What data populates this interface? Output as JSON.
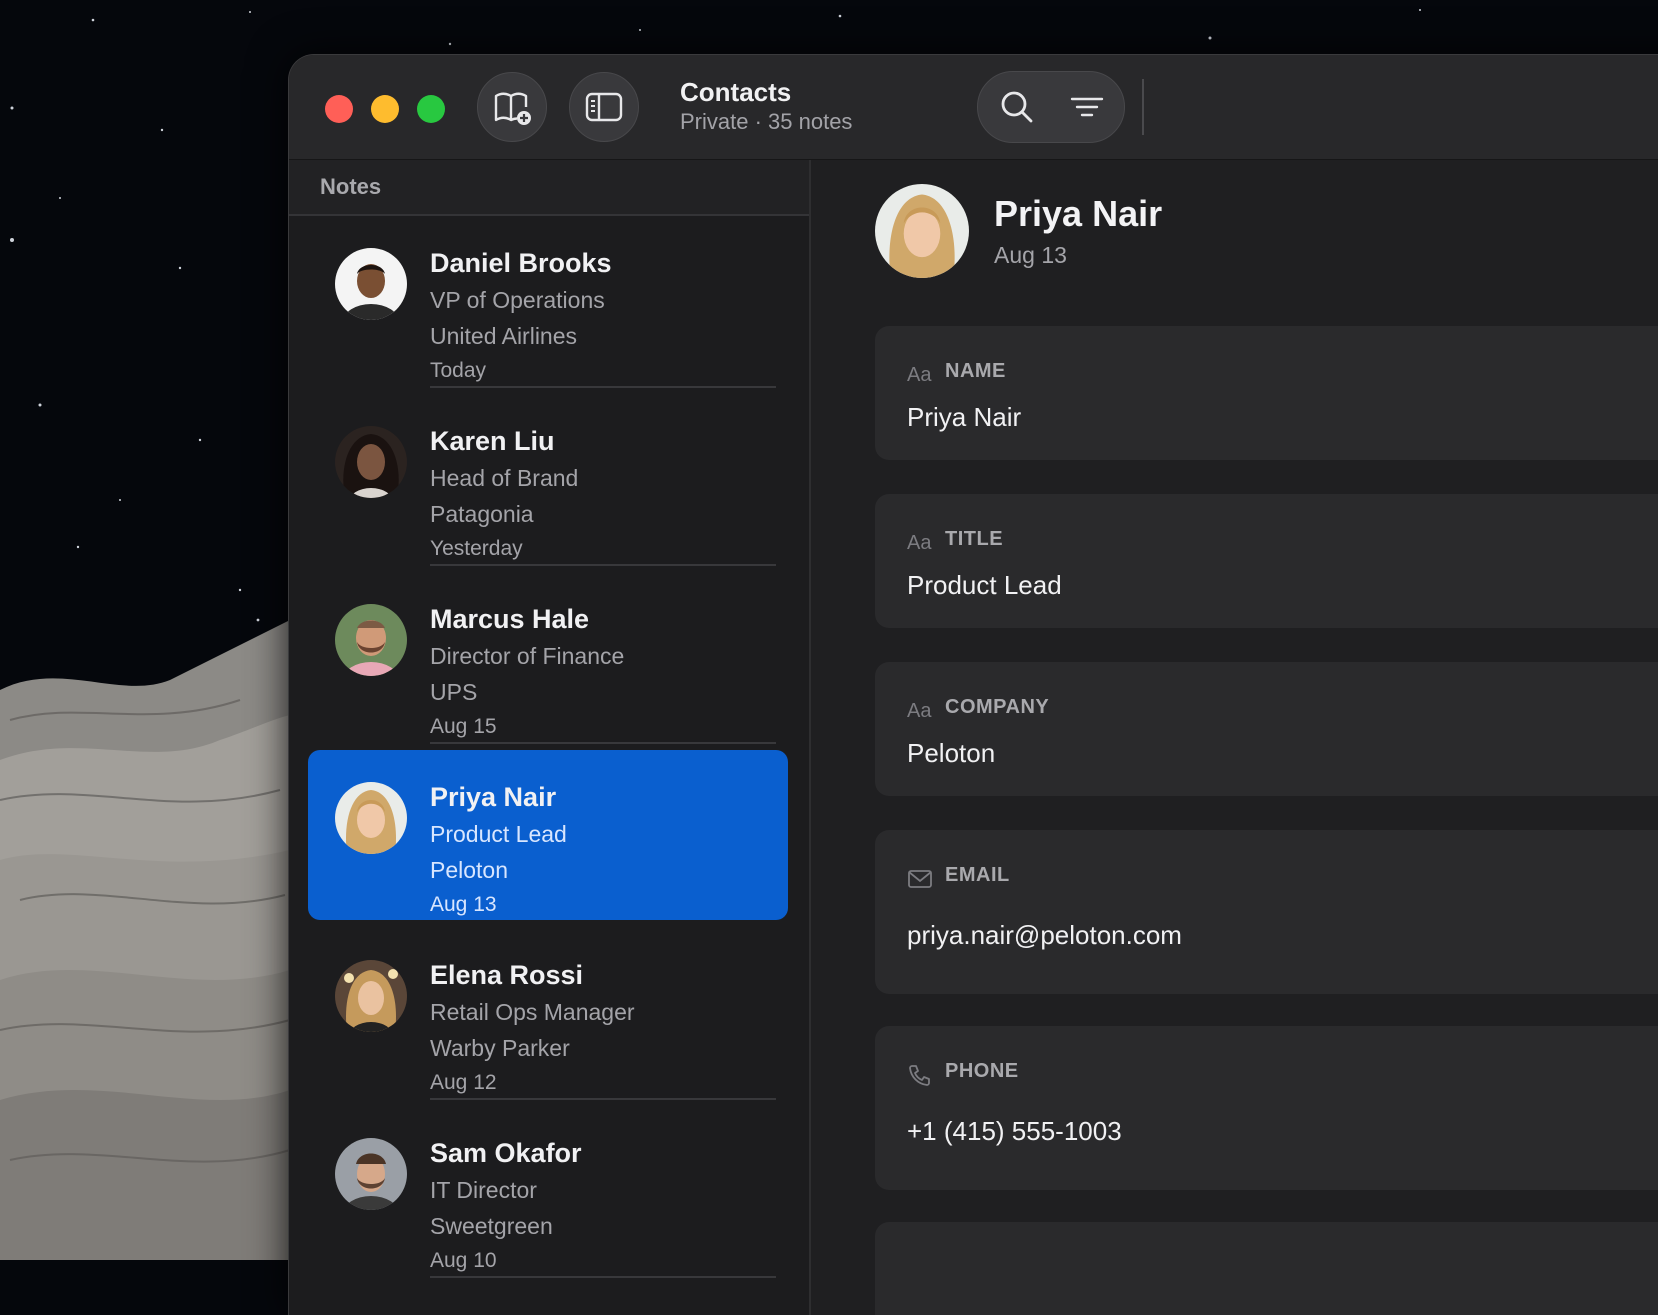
{
  "app": {
    "title": "Contacts",
    "subtitle": "Private · 35 notes"
  },
  "toolbar": {
    "icons": [
      "new-notebook-icon",
      "sidebar-toggle-icon",
      "search-icon",
      "filter-icon"
    ]
  },
  "sidebar": {
    "header": "Notes",
    "notes": [
      {
        "name": "Daniel Brooks",
        "title": "VP of Operations",
        "company": "United Airlines",
        "date": "Today",
        "selected": false
      },
      {
        "name": "Karen Liu",
        "title": "Head of Brand",
        "company": "Patagonia",
        "date": "Yesterday",
        "selected": false
      },
      {
        "name": "Marcus Hale",
        "title": "Director of Finance",
        "company": "UPS",
        "date": "Aug 15",
        "selected": false
      },
      {
        "name": "Priya Nair",
        "title": "Product Lead",
        "company": "Peloton",
        "date": "Aug 13",
        "selected": true
      },
      {
        "name": "Elena Rossi",
        "title": "Retail Ops Manager",
        "company": "Warby Parker",
        "date": "Aug 12",
        "selected": false
      },
      {
        "name": "Sam Okafor",
        "title": "IT Director",
        "company": "Sweetgreen",
        "date": "Aug 10",
        "selected": false
      }
    ]
  },
  "detail": {
    "name": "Priya Nair",
    "date": "Aug 13",
    "fields": [
      {
        "label": "NAME",
        "icon": "text-icon",
        "value": "Priya Nair"
      },
      {
        "label": "TITLE",
        "icon": "text-icon",
        "value": "Product Lead"
      },
      {
        "label": "COMPANY",
        "icon": "text-icon",
        "value": "Peloton"
      },
      {
        "label": "EMAIL",
        "icon": "envelope-icon",
        "value": "priya.nair@peloton.com"
      },
      {
        "label": "PHONE",
        "icon": "phone-icon",
        "value": "+1 (415) 555-1003"
      }
    ],
    "text_icon_glyph": "Aa"
  },
  "colors": {
    "selection": "#0a5fcf",
    "close": "#ff5f57",
    "minimize": "#febc2e",
    "zoom": "#28c840"
  }
}
